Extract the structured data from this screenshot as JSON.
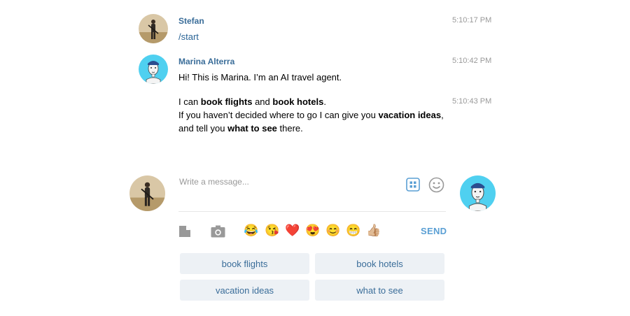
{
  "messages": [
    {
      "sender": "Stefan",
      "time": "5:10:17 PM",
      "text": "/start"
    },
    {
      "sender": "Marina Alterra",
      "time": "5:10:42 PM",
      "text": "Hi! This is Marina. I’m an AI travel agent."
    },
    {
      "time": "5:10:43 PM",
      "line1": {
        "a": "I can ",
        "b": "book flights",
        "c": " and ",
        "d": "book hotels",
        "e": "."
      },
      "line2": {
        "a": "If you haven’t decided where to go I can give you ",
        "b": "vacation ideas",
        "c": ","
      },
      "line3": {
        "a": "and tell you ",
        "b": "what to see",
        "c": " there."
      }
    }
  ],
  "composer": {
    "placeholder": "Write a message...",
    "send_label": "SEND",
    "emojis": [
      "😂",
      "😘",
      "❤️",
      "😍",
      "😊",
      "😁",
      "👍🏼"
    ]
  },
  "keyboard": {
    "buttons": [
      "book flights",
      "book hotels",
      "vacation ideas",
      "what to see"
    ]
  },
  "colors": {
    "name": "#3a6d99",
    "send": "#5a9fd4",
    "keyboard_bg": "#edf1f5",
    "bot_avatar_bg": "#4fd0f0"
  }
}
